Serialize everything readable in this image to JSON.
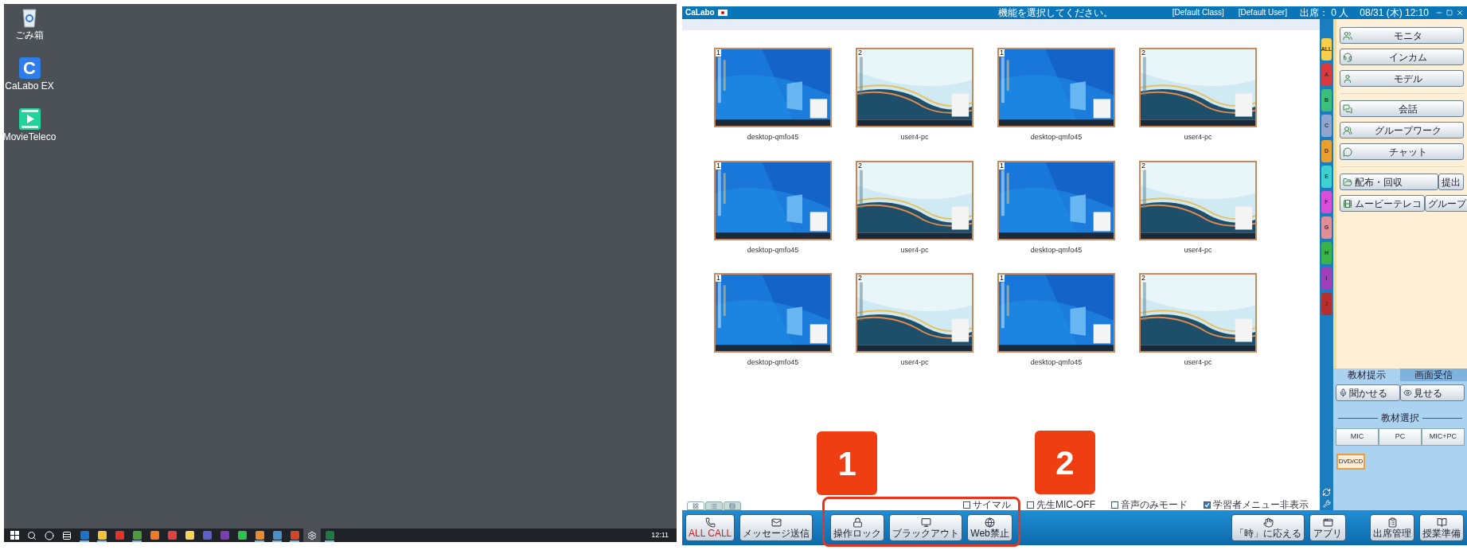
{
  "desktop": {
    "icons": [
      {
        "kind": "bin",
        "label": "ごみ箱"
      },
      {
        "kind": "app-c",
        "glyph": "C",
        "label": "CaLabo EX"
      },
      {
        "kind": "film",
        "label": "MovieTeleco"
      }
    ],
    "taskbar": {
      "items": [
        {
          "kind": "start",
          "running": false
        },
        {
          "kind": "search",
          "running": false
        },
        {
          "kind": "cortana",
          "running": false
        },
        {
          "kind": "task-view",
          "running": false
        },
        {
          "kind": "app",
          "color": "#1a73c8",
          "running": true
        },
        {
          "kind": "app",
          "color": "#f3c23c",
          "running": true
        },
        {
          "kind": "app",
          "color": "#e0332c",
          "running": false
        },
        {
          "kind": "app",
          "color": "#4c9b3c",
          "running": true
        },
        {
          "kind": "app",
          "color": "#f07a24",
          "running": false
        },
        {
          "kind": "app",
          "color": "#e34040",
          "running": false
        },
        {
          "kind": "app",
          "color": "#f5d35a",
          "running": false
        },
        {
          "kind": "app",
          "color": "#5b5fc7",
          "running": false
        },
        {
          "kind": "app",
          "color": "#7b3fb3",
          "running": false
        },
        {
          "kind": "app",
          "color": "#2ec14f",
          "running": false
        },
        {
          "kind": "app",
          "color": "#e98a2c",
          "running": true
        },
        {
          "kind": "app",
          "color": "#4a90c8",
          "running": true
        },
        {
          "kind": "app",
          "color": "#d24726",
          "running": true
        },
        {
          "kind": "settings",
          "running": false
        },
        {
          "kind": "app",
          "color": "#1d7a45",
          "running": true
        }
      ],
      "clock": "12:11"
    }
  },
  "app": {
    "title_bar": {
      "app_name": "CaLabo",
      "message": "機能を選択してください。",
      "class": "[Default Class]",
      "user": "[Default User]",
      "attendance": "出席： 0 人",
      "datetime": "08/31 (木) 12:10"
    },
    "tiles": [
      {
        "number": "1",
        "name": "desktop-qmfo45",
        "kind": "blue"
      },
      {
        "number": "2",
        "name": "user4-pc",
        "kind": "teal"
      },
      {
        "number": "1",
        "name": "desktop-qmfo45",
        "kind": "blue"
      },
      {
        "number": "2",
        "name": "user4-pc",
        "kind": "teal"
      },
      {
        "number": "1",
        "name": "desktop-qmfo45",
        "kind": "blue"
      },
      {
        "number": "2",
        "name": "user4-pc",
        "kind": "teal"
      },
      {
        "number": "1",
        "name": "desktop-qmfo45",
        "kind": "blue"
      },
      {
        "number": "2",
        "name": "user4-pc",
        "kind": "teal"
      },
      {
        "number": "1",
        "name": "desktop-qmfo45",
        "kind": "blue"
      },
      {
        "number": "2",
        "name": "user4-pc",
        "kind": "teal"
      },
      {
        "number": "1",
        "name": "desktop-qmfo45",
        "kind": "blue"
      },
      {
        "number": "2",
        "name": "user4-pc",
        "kind": "teal"
      }
    ],
    "group_tabs": [
      {
        "label": "ALL",
        "color": "#f7cf4a"
      },
      {
        "label": "A",
        "color": "#d9393c"
      },
      {
        "label": "B",
        "color": "#3cbf7a"
      },
      {
        "label": "C",
        "color": "#8fa7cf"
      },
      {
        "label": "D",
        "color": "#e9a030"
      },
      {
        "label": "E",
        "color": "#3fd1cf"
      },
      {
        "label": "F",
        "color": "#d94fd9"
      },
      {
        "label": "G",
        "color": "#e08e98"
      },
      {
        "label": "H",
        "color": "#39b34a"
      },
      {
        "label": "I",
        "color": "#a040b8"
      },
      {
        "label": "J",
        "color": "#b5302c"
      }
    ],
    "side_groups": [
      [
        {
          "label": "モニタ"
        },
        {
          "label": "インカム"
        },
        {
          "label": "モデル"
        }
      ],
      [
        {
          "label": "会話"
        },
        {
          "label": "グループワーク"
        },
        {
          "label": "チャット"
        }
      ],
      [
        {
          "label": "配布・回収",
          "second": "提出"
        },
        {
          "label": "ムービーテレコ",
          "second": "グループ"
        }
      ]
    ],
    "material": {
      "tabs": [
        {
          "label": "教材提示",
          "selected": true
        },
        {
          "label": "画面受信",
          "selected": false
        }
      ],
      "buttons": [
        "聞かせる",
        "見せる"
      ],
      "section": "教材選択",
      "sources": [
        "MIC",
        "PC",
        "MIC+PC"
      ],
      "dvd": {
        "label": "DVD/CD",
        "selected": true
      }
    },
    "view_tabs": [
      {
        "selected": true
      },
      {
        "selected": false
      },
      {
        "selected": false
      }
    ],
    "options": [
      {
        "label": "サイマル",
        "checked": false
      },
      {
        "label": "先生MIC-OFF",
        "checked": false
      },
      {
        "label": "音声のみモード",
        "checked": false
      },
      {
        "label": "学習者メニュー非表示",
        "checked": true
      }
    ],
    "bottom_left": [
      {
        "label": "ALL CALL",
        "kind": "alert"
      },
      {
        "label": "メッセージ送信",
        "kind": "plain"
      }
    ],
    "bottom_middle": [
      {
        "label": "操作ロック",
        "kind": "plain"
      },
      {
        "label": "ブラックアウト",
        "kind": "plain"
      },
      {
        "label": "Web禁止",
        "kind": "plain"
      }
    ],
    "bottom_right": [
      {
        "label": "「時」に応える",
        "kind": "plain"
      },
      {
        "label": "アプリ",
        "kind": "plain"
      },
      {
        "label": "出席管理",
        "kind": "plain"
      },
      {
        "label": "授業準備",
        "kind": "plain"
      }
    ]
  },
  "annotations": [
    {
      "label": "1"
    },
    {
      "label": "2"
    }
  ]
}
